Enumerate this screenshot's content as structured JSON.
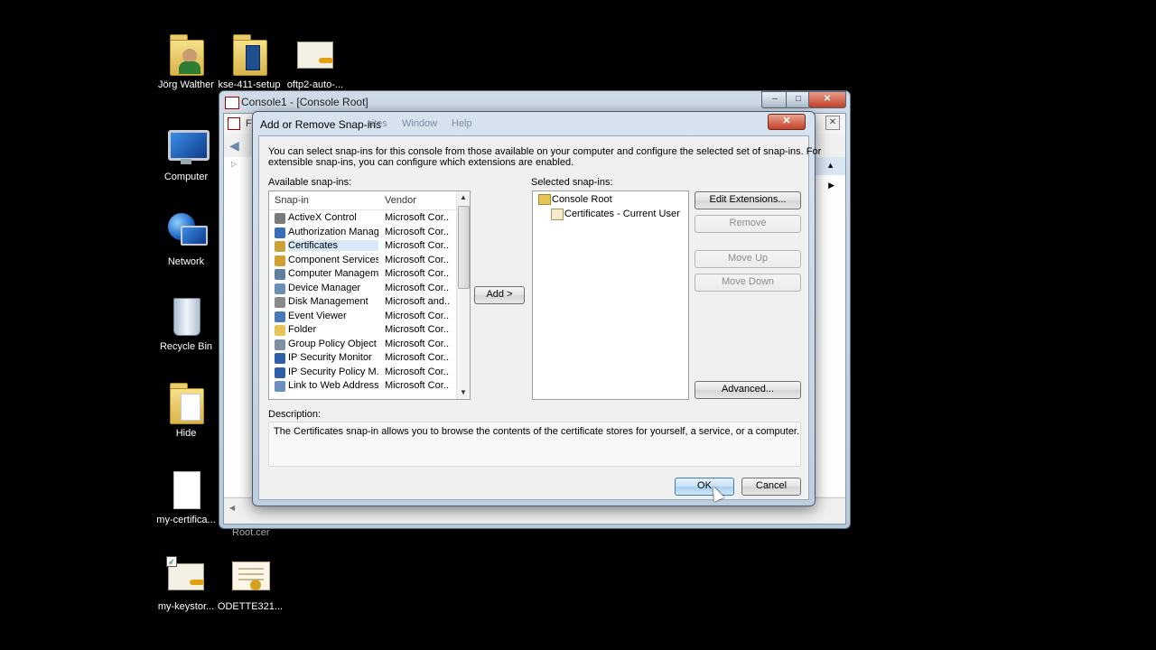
{
  "desktop": {
    "icons": [
      {
        "label": "Jörg Walther",
        "icon": "user-folder-icon"
      },
      {
        "label": "kse-411-setup",
        "icon": "folder-icon"
      },
      {
        "label": "oftp2-auto-...",
        "icon": "keystore-file-icon"
      },
      {
        "label": "Computer",
        "icon": "computer-icon"
      },
      {
        "label": "Network",
        "icon": "network-icon"
      },
      {
        "label": "Recycle Bin",
        "icon": "recycle-bin-icon"
      },
      {
        "label": "Hide",
        "icon": "folder-icon"
      },
      {
        "label": "my-certifica...",
        "icon": "file-icon"
      },
      {
        "label": "my-keystor...",
        "icon": "keystore-file-icon"
      },
      {
        "label": "ODETTE321...",
        "icon": "certificate-icon"
      }
    ],
    "behind_label": "Root.cer"
  },
  "mmc_window": {
    "title": "Console1 - [Console Root]",
    "menu_fragment": "Fi",
    "minimize": "–",
    "maximize": "□",
    "close": "✕"
  },
  "dialog": {
    "title": "Add or Remove Snap-ins",
    "behind_menu": [
      "rites",
      "Window",
      "Help"
    ],
    "close": "✕",
    "intro": [
      "You can select snap-ins for this console from those available on your computer and configure the selected set of snap-ins. For",
      "extensible snap-ins, you can configure which extensions are enabled."
    ],
    "available_label": "Available snap-ins:",
    "selected_label": "Selected snap-ins:",
    "columns": {
      "snapin": "Snap-in",
      "vendor": "Vendor"
    },
    "snapins": [
      {
        "name": "ActiveX Control",
        "vendor": "Microsoft Cor...",
        "color": "#7a7a7a"
      },
      {
        "name": "Authorization Manager",
        "vendor": "Microsoft Cor...",
        "color": "#3b6cb6"
      },
      {
        "name": "Certificates",
        "vendor": "Microsoft Cor...",
        "color": "#c9a23a"
      },
      {
        "name": "Component Services",
        "vendor": "Microsoft Cor...",
        "color": "#d0a030"
      },
      {
        "name": "Computer Managem...",
        "vendor": "Microsoft Cor...",
        "color": "#5f7f9f"
      },
      {
        "name": "Device Manager",
        "vendor": "Microsoft Cor...",
        "color": "#6b8fb0"
      },
      {
        "name": "Disk Management",
        "vendor": "Microsoft and...",
        "color": "#8a8a8a"
      },
      {
        "name": "Event Viewer",
        "vendor": "Microsoft Cor...",
        "color": "#4a7ab8"
      },
      {
        "name": "Folder",
        "vendor": "Microsoft Cor...",
        "color": "#e6c458"
      },
      {
        "name": "Group Policy Object ...",
        "vendor": "Microsoft Cor...",
        "color": "#7f8fa0"
      },
      {
        "name": "IP Security Monitor",
        "vendor": "Microsoft Cor...",
        "color": "#2e5fa8"
      },
      {
        "name": "IP Security Policy M...",
        "vendor": "Microsoft Cor...",
        "color": "#2e5fa8"
      },
      {
        "name": "Link to Web Address",
        "vendor": "Microsoft Cor...",
        "color": "#6a8fc0"
      }
    ],
    "selected_index": 2,
    "add_button": "Add >",
    "selected_tree": [
      {
        "label": "Console Root",
        "level": 0
      },
      {
        "label": "Certificates - Current User",
        "level": 1
      }
    ],
    "buttons": {
      "edit_extensions": "Edit Extensions...",
      "remove": "Remove",
      "move_up": "Move Up",
      "move_down": "Move Down",
      "advanced": "Advanced...",
      "ok": "OK",
      "cancel": "Cancel"
    },
    "description_label": "Description:",
    "description_text": "The Certificates snap-in allows you to browse the contents of the certificate stores for yourself, a service, or a computer."
  },
  "colors": {
    "desktop_bg": "#000000",
    "dialog_frame": "#bccfe1",
    "selection": "#d8e8f8",
    "default_button": "#a8d0f0"
  }
}
